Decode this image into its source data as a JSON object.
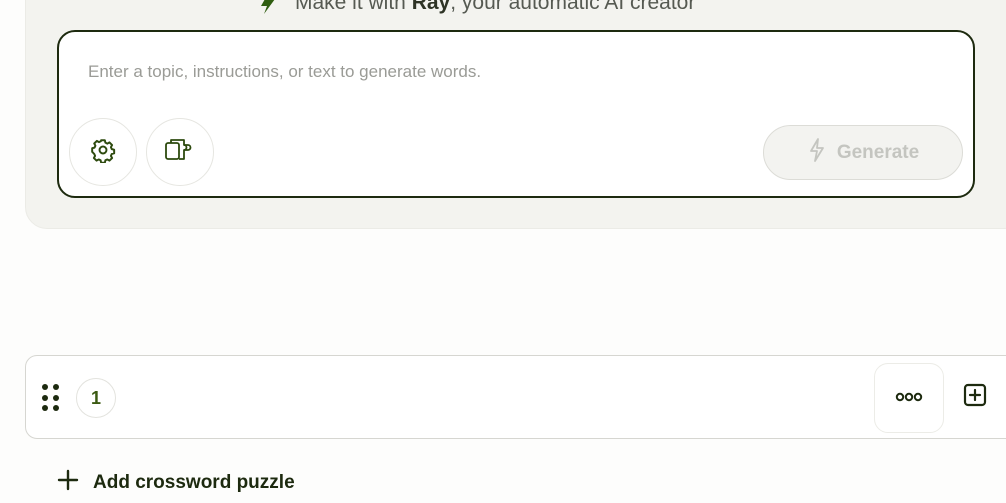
{
  "ai_panel": {
    "headline_prefix": "Make it with ",
    "headline_brand": "Ray",
    "headline_suffix": ", your automatic AI creator",
    "prompt_placeholder": "Enter a topic, instructions, or text to generate words.",
    "settings_icon": "gear-icon",
    "import_icon": "puzzle-import-icon",
    "generate_label": "Generate",
    "generate_icon": "lightning-icon"
  },
  "items": [
    {
      "number": "1"
    }
  ],
  "item_actions": {
    "more_icon": "more-dots-icon",
    "add_icon": "plus-square-icon"
  },
  "add_puzzle_label": "Add crossword puzzle",
  "colors": {
    "accent_dark": "#1d2a0f",
    "panel_bg": "#f3f3ef",
    "badge_text": "#3b5a12"
  }
}
